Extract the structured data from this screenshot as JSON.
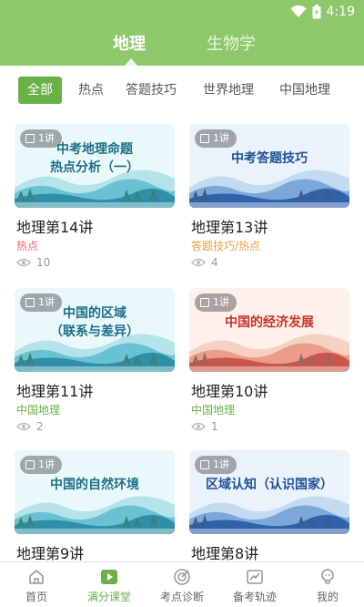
{
  "status_bar": {
    "time": "4:19",
    "icons": [
      "wifi-icon",
      "battery-icon"
    ]
  },
  "main_tabs": [
    {
      "label": "地理",
      "active": true
    },
    {
      "label": "生物学",
      "active": false
    }
  ],
  "filters": [
    {
      "label": "全部",
      "active": true
    },
    {
      "label": "热点",
      "active": false
    },
    {
      "label": "答题技巧",
      "active": false
    },
    {
      "label": "世界地理",
      "active": false
    },
    {
      "label": "中国地理",
      "active": false
    }
  ],
  "cards": [
    {
      "badge": "1讲",
      "thumb_title": "中考地理命题\n热点分析（一）",
      "title": "地理第14讲",
      "tag": "热点",
      "tag_color": "#e86b6b",
      "views": "10",
      "theme": "cyan"
    },
    {
      "badge": "1讲",
      "thumb_title": "中考答题技巧",
      "title": "地理第13讲",
      "tag": "答题技巧/热点",
      "tag_color": "#e8a23a",
      "views": "4",
      "theme": "blue"
    },
    {
      "badge": "1讲",
      "thumb_title": "中国的区域\n（联系与差异）",
      "title": "地理第11讲",
      "tag": "中国地理",
      "tag_color": "#6ab247",
      "views": "2",
      "theme": "cyan"
    },
    {
      "badge": "1讲",
      "thumb_title": "中国的经济发展",
      "title": "地理第10讲",
      "tag": "中国地理",
      "tag_color": "#6ab247",
      "views": "1",
      "theme": "red"
    },
    {
      "badge": "1讲",
      "thumb_title": "中国的自然环境",
      "title": "地理第9讲",
      "tag": "",
      "tag_color": "#6ab247",
      "views": "",
      "theme": "cyan"
    },
    {
      "badge": "1讲",
      "thumb_title": "区域认知（认识国家）",
      "title": "地理第8讲",
      "tag": "",
      "tag_color": "#6ab247",
      "views": "",
      "theme": "blue"
    }
  ],
  "bottom_nav": [
    {
      "label": "首页",
      "icon": "home-icon",
      "active": false
    },
    {
      "label": "满分课堂",
      "icon": "play-icon",
      "active": true
    },
    {
      "label": "考点诊断",
      "icon": "target-icon",
      "active": false
    },
    {
      "label": "备考轨迹",
      "icon": "chart-icon",
      "active": false
    },
    {
      "label": "我的",
      "icon": "profile-icon",
      "active": false
    }
  ],
  "colors": {
    "brand_green": "#8dc86a",
    "chip_green": "#6ab247"
  }
}
